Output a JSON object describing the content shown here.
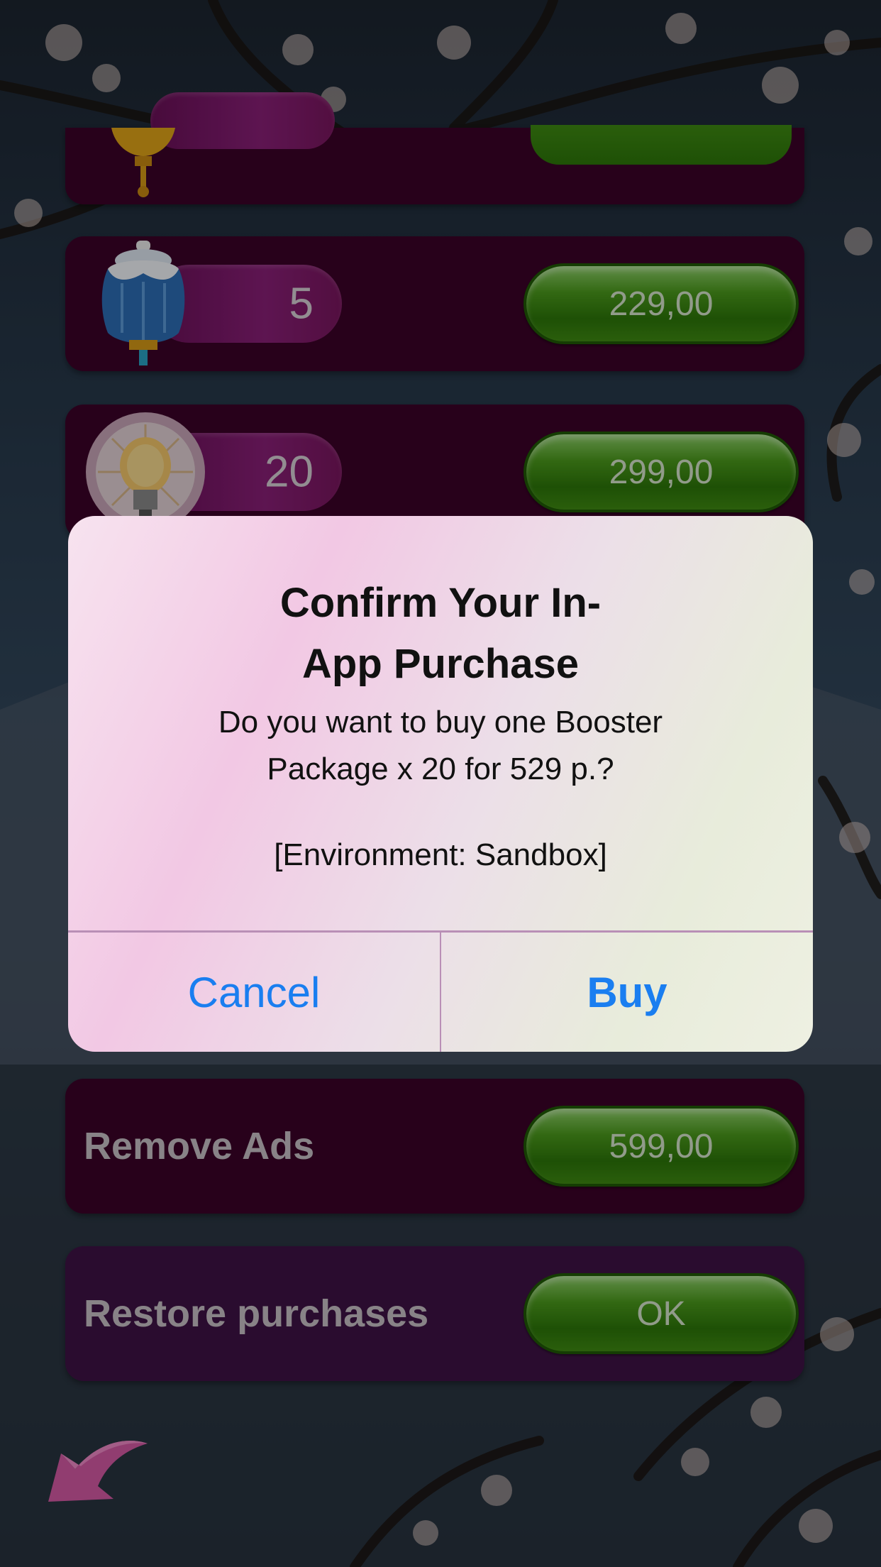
{
  "shop": {
    "items": [
      {
        "count": "",
        "price": ""
      },
      {
        "count": "5",
        "price": "229,00"
      },
      {
        "count": "20",
        "price": "299,00"
      }
    ],
    "remove_ads": {
      "label": "Remove Ads",
      "price": "599,00"
    },
    "restore": {
      "label": "Restore purchases",
      "button": "OK"
    }
  },
  "alert": {
    "title": "Confirm Your In-\nApp Purchase",
    "message": "Do you want to buy one Booster\nPackage x 20 for 529 p.?",
    "environment": "[Environment: Sandbox]",
    "cancel_label": "Cancel",
    "buy_label": "Buy"
  },
  "colors": {
    "row_bg": "#3c0229",
    "restore_bg": "#3f1346",
    "button_green": "#2d7709",
    "alert_link": "#1a7ef0"
  },
  "icons": [
    "lantern-gold-icon",
    "lantern-blue-icon",
    "lightbulb-icon",
    "back-arrow-icon"
  ]
}
